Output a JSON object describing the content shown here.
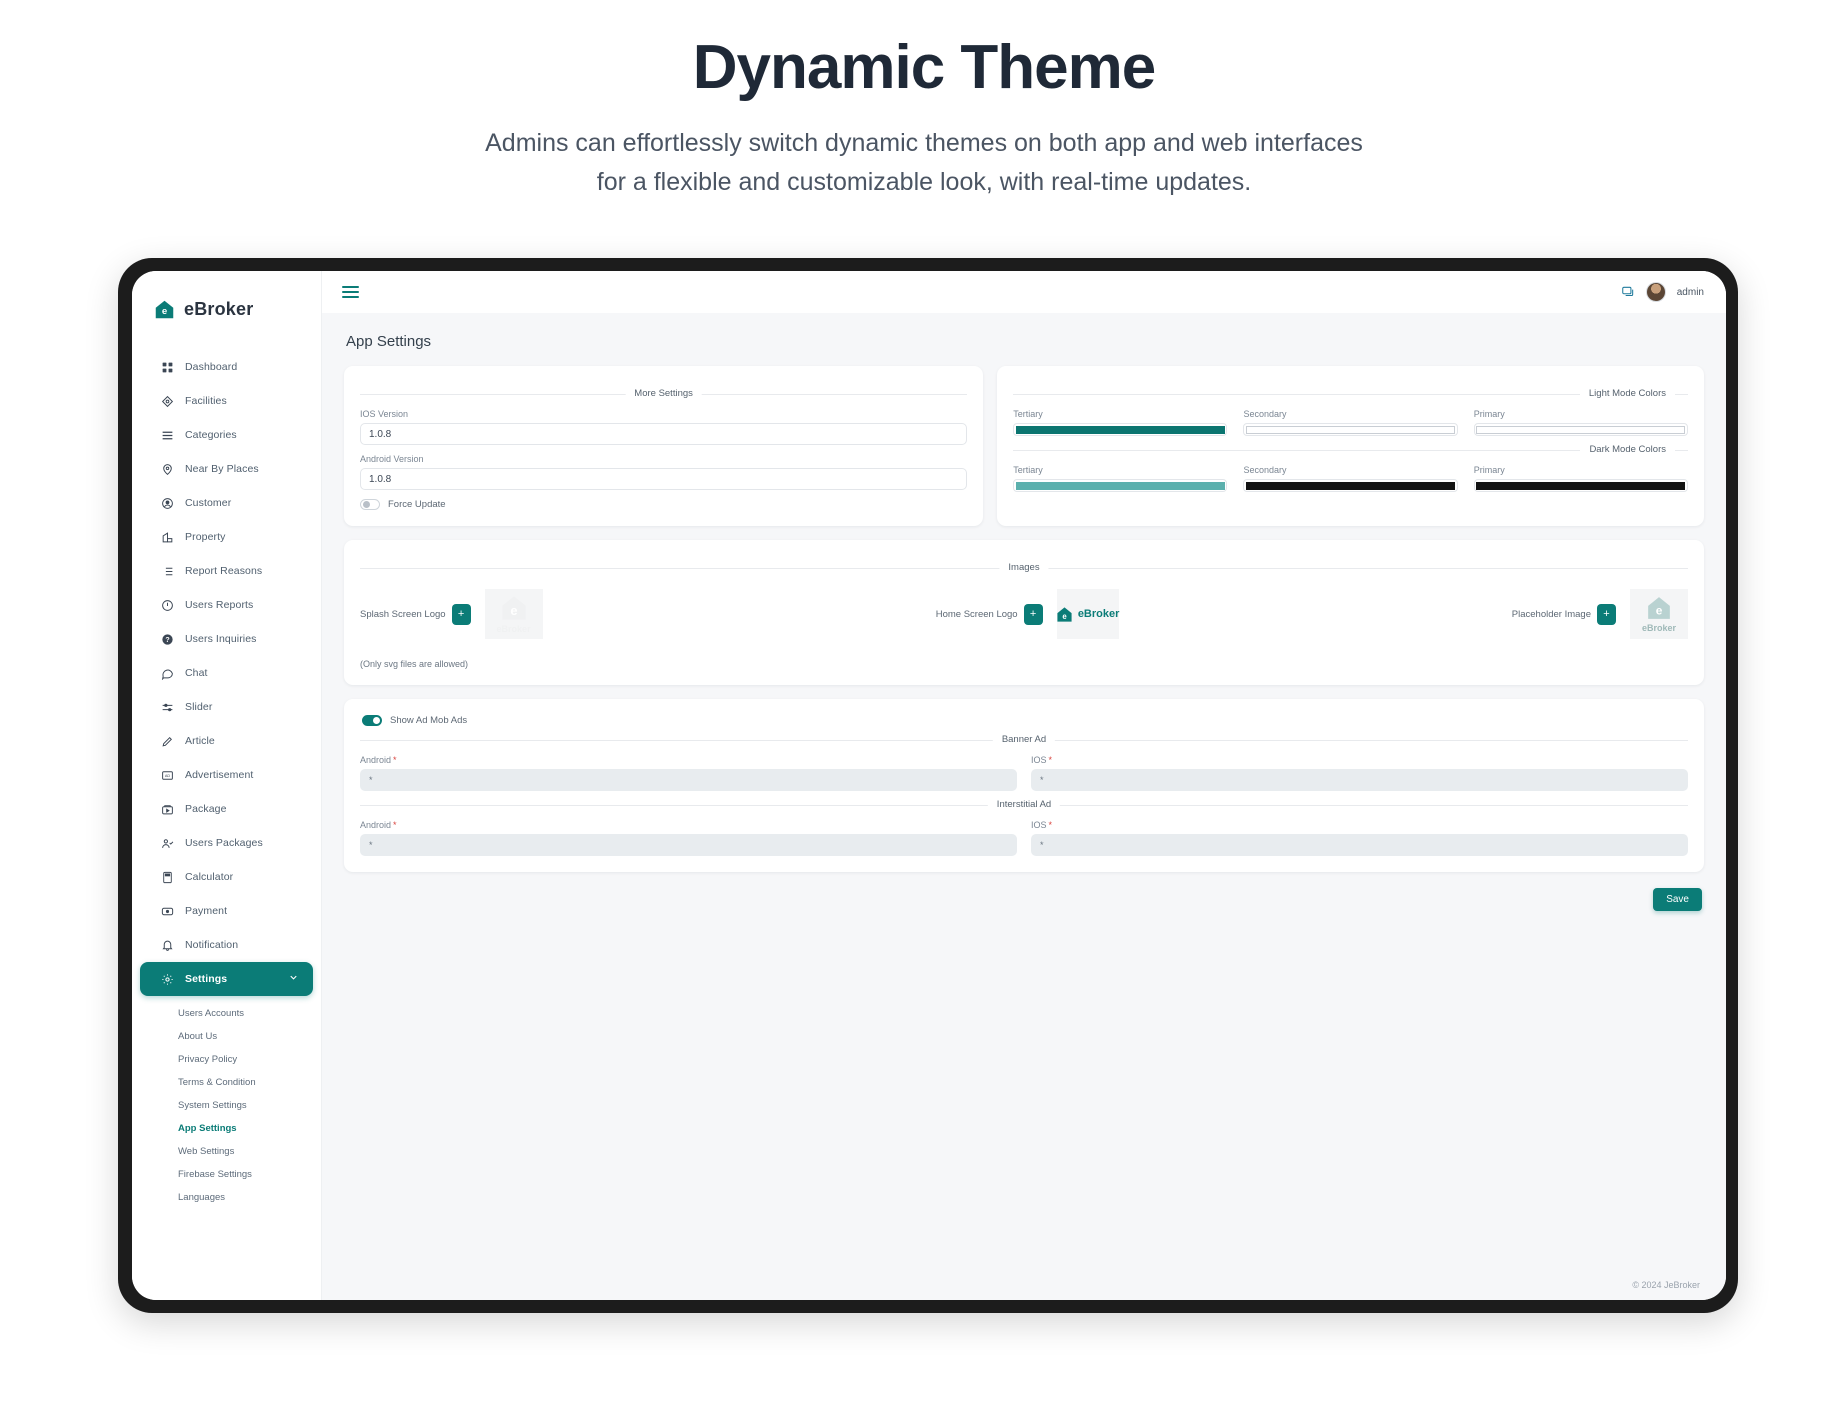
{
  "hero": {
    "title": "Dynamic Theme",
    "subtitle_line1": "Admins can effortlessly switch dynamic themes on both app and web interfaces",
    "subtitle_line2": "for a flexible and customizable look, with real-time updates."
  },
  "brand": {
    "name": "eBroker",
    "logo_icon": "ebroker-house-logo-icon"
  },
  "sidebar": {
    "items": [
      {
        "label": "Dashboard",
        "icon": "grid-icon"
      },
      {
        "label": "Facilities",
        "icon": "diamond-icon"
      },
      {
        "label": "Categories",
        "icon": "list-lines-icon"
      },
      {
        "label": "Near By Places",
        "icon": "map-pin-icon"
      },
      {
        "label": "Customer",
        "icon": "user-circle-icon"
      },
      {
        "label": "Property",
        "icon": "building-icon"
      },
      {
        "label": "Report Reasons",
        "icon": "list-bullet-icon"
      },
      {
        "label": "Users Reports",
        "icon": "alert-circle-icon"
      },
      {
        "label": "Users Inquiries",
        "icon": "question-circle-icon"
      },
      {
        "label": "Chat",
        "icon": "chat-bubble-icon"
      },
      {
        "label": "Slider",
        "icon": "sliders-icon"
      },
      {
        "label": "Article",
        "icon": "pen-icon"
      },
      {
        "label": "Advertisement",
        "icon": "ad-box-icon"
      },
      {
        "label": "Package",
        "icon": "package-box-icon"
      },
      {
        "label": "Users Packages",
        "icon": "user-check-icon"
      },
      {
        "label": "Calculator",
        "icon": "calculator-icon"
      },
      {
        "label": "Payment",
        "icon": "credit-card-icon"
      },
      {
        "label": "Notification",
        "icon": "bell-icon"
      }
    ],
    "settings": {
      "label": "Settings",
      "icon": "gear-icon",
      "chevron": "chevron-down-icon",
      "active": true
    },
    "submenu": [
      {
        "label": "Users Accounts",
        "active": false
      },
      {
        "label": "About Us",
        "active": false
      },
      {
        "label": "Privacy Policy",
        "active": false
      },
      {
        "label": "Terms & Condition",
        "active": false
      },
      {
        "label": "System Settings",
        "active": false
      },
      {
        "label": "App Settings",
        "active": true
      },
      {
        "label": "Web Settings",
        "active": false
      },
      {
        "label": "Firebase Settings",
        "active": false
      },
      {
        "label": "Languages",
        "active": false
      }
    ]
  },
  "topbar": {
    "menu_icon": "hamburger-icon",
    "message_icon": "message-square-icon",
    "avatar_icon": "user-avatar",
    "username": "admin"
  },
  "main": {
    "page_title": "App Settings",
    "more_settings": {
      "legend": "More Settings",
      "ios_version": {
        "label": "IOS Version",
        "value": "1.0.8"
      },
      "android_version": {
        "label": "Android Version",
        "value": "1.0.8"
      },
      "force_update": {
        "label": "Force Update",
        "on": false
      }
    },
    "light_mode": {
      "legend": "Light Mode Colors",
      "colors": [
        {
          "label": "Tertiary",
          "hex": "#0b7570"
        },
        {
          "label": "Secondary",
          "hex": "#ffffff"
        },
        {
          "label": "Primary",
          "hex": "#ffffff"
        }
      ]
    },
    "dark_mode": {
      "legend": "Dark Mode Colors",
      "colors": [
        {
          "label": "Tertiary",
          "hex": "#5bb0ad"
        },
        {
          "label": "Secondary",
          "hex": "#131313"
        },
        {
          "label": "Primary",
          "hex": "#131313"
        }
      ]
    },
    "images": {
      "legend": "Images",
      "slots": [
        {
          "label": "Splash Screen Logo",
          "button": "+",
          "preview": "ebroker-splash-logo"
        },
        {
          "label": "Home Screen Logo",
          "button": "+",
          "preview": "ebroker-home-logo"
        },
        {
          "label": "Placeholder Image",
          "button": "+",
          "preview": "ebroker-placeholder-logo"
        }
      ],
      "note": "(Only svg files are allowed)"
    },
    "admob": {
      "toggle": {
        "label": "Show Ad Mob Ads",
        "on": true
      },
      "banner": {
        "legend": "Banner Ad",
        "android": {
          "label": "Android",
          "required": "*",
          "value": "*"
        },
        "ios": {
          "label": "IOS",
          "required": "*",
          "value": "*"
        }
      },
      "interstitial": {
        "legend": "Interstitial Ad",
        "android": {
          "label": "Android",
          "required": "*",
          "value": "*"
        },
        "ios": {
          "label": "IOS",
          "required": "*",
          "value": "*"
        }
      }
    },
    "save_label": "Save",
    "footer": "© 2024 JeBroker"
  },
  "theme": {
    "accent": "#0b7c77",
    "page_bg": "#f6f7f9"
  }
}
